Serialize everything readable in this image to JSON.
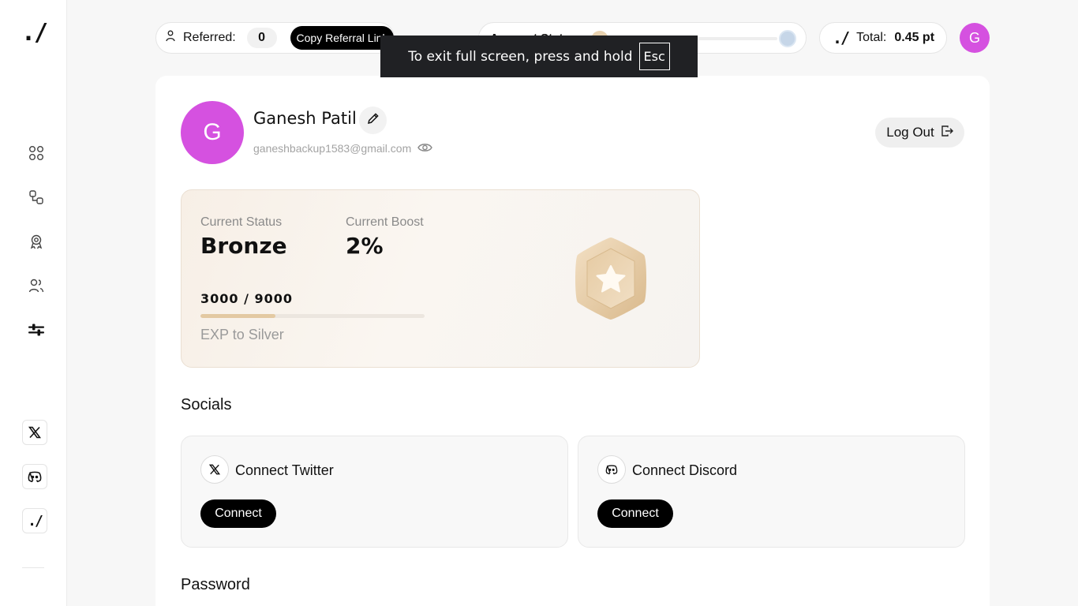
{
  "sidebar": {
    "logo": "./",
    "nav_icons": [
      "dashboard-icon",
      "tasks-icon",
      "rewards-icon",
      "referrals-icon",
      "settings-icon"
    ],
    "social_icons": [
      "x-icon",
      "discord-icon",
      "brand-icon"
    ],
    "brand_icon_text": "./"
  },
  "topbar": {
    "referred_label": "Referred:",
    "referred_count": "0",
    "copy_button": "Copy Referral Link",
    "status_label": "Account Status",
    "total_logo": "./",
    "total_label": "Total:",
    "total_value": "0.45 pt",
    "avatar_initial": "G"
  },
  "toast": {
    "message": "To exit full screen, press and hold",
    "key": "Esc"
  },
  "profile": {
    "avatar_initial": "G",
    "name": "Ganesh Patil",
    "email": "ganeshbackup1583@gmail.com",
    "logout_label": "Log Out"
  },
  "status_card": {
    "status_label": "Current Status",
    "status_value": "Bronze",
    "boost_label": "Current Boost",
    "boost_value": "2%",
    "exp_text": "3000 / 9000",
    "exp_current": 3000,
    "exp_target": 9000,
    "next_text": "EXP to Silver"
  },
  "socials": {
    "title": "Socials",
    "twitter": {
      "title": "Connect Twitter",
      "button": "Connect"
    },
    "discord": {
      "title": "Connect Discord",
      "button": "Connect"
    }
  },
  "password": {
    "title": "Password"
  },
  "colors": {
    "accent_avatar": "#d551e0",
    "bronze": "#e3c9a2",
    "silver": "#c6d6e8",
    "toast_bg": "#202124"
  }
}
